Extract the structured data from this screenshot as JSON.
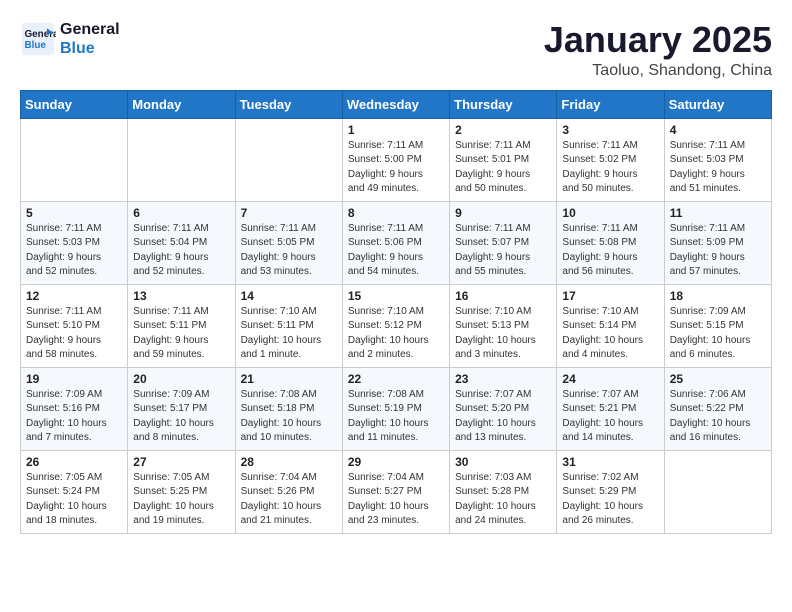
{
  "header": {
    "logo_line1": "General",
    "logo_line2": "Blue",
    "main_title": "January 2025",
    "subtitle": "Taoluo, Shandong, China"
  },
  "days_of_week": [
    "Sunday",
    "Monday",
    "Tuesday",
    "Wednesday",
    "Thursday",
    "Friday",
    "Saturday"
  ],
  "weeks": [
    [
      {
        "day": "",
        "info": ""
      },
      {
        "day": "",
        "info": ""
      },
      {
        "day": "",
        "info": ""
      },
      {
        "day": "1",
        "info": "Sunrise: 7:11 AM\nSunset: 5:00 PM\nDaylight: 9 hours\nand 49 minutes."
      },
      {
        "day": "2",
        "info": "Sunrise: 7:11 AM\nSunset: 5:01 PM\nDaylight: 9 hours\nand 50 minutes."
      },
      {
        "day": "3",
        "info": "Sunrise: 7:11 AM\nSunset: 5:02 PM\nDaylight: 9 hours\nand 50 minutes."
      },
      {
        "day": "4",
        "info": "Sunrise: 7:11 AM\nSunset: 5:03 PM\nDaylight: 9 hours\nand 51 minutes."
      }
    ],
    [
      {
        "day": "5",
        "info": "Sunrise: 7:11 AM\nSunset: 5:03 PM\nDaylight: 9 hours\nand 52 minutes."
      },
      {
        "day": "6",
        "info": "Sunrise: 7:11 AM\nSunset: 5:04 PM\nDaylight: 9 hours\nand 52 minutes."
      },
      {
        "day": "7",
        "info": "Sunrise: 7:11 AM\nSunset: 5:05 PM\nDaylight: 9 hours\nand 53 minutes."
      },
      {
        "day": "8",
        "info": "Sunrise: 7:11 AM\nSunset: 5:06 PM\nDaylight: 9 hours\nand 54 minutes."
      },
      {
        "day": "9",
        "info": "Sunrise: 7:11 AM\nSunset: 5:07 PM\nDaylight: 9 hours\nand 55 minutes."
      },
      {
        "day": "10",
        "info": "Sunrise: 7:11 AM\nSunset: 5:08 PM\nDaylight: 9 hours\nand 56 minutes."
      },
      {
        "day": "11",
        "info": "Sunrise: 7:11 AM\nSunset: 5:09 PM\nDaylight: 9 hours\nand 57 minutes."
      }
    ],
    [
      {
        "day": "12",
        "info": "Sunrise: 7:11 AM\nSunset: 5:10 PM\nDaylight: 9 hours\nand 58 minutes."
      },
      {
        "day": "13",
        "info": "Sunrise: 7:11 AM\nSunset: 5:11 PM\nDaylight: 9 hours\nand 59 minutes."
      },
      {
        "day": "14",
        "info": "Sunrise: 7:10 AM\nSunset: 5:11 PM\nDaylight: 10 hours\nand 1 minute."
      },
      {
        "day": "15",
        "info": "Sunrise: 7:10 AM\nSunset: 5:12 PM\nDaylight: 10 hours\nand 2 minutes."
      },
      {
        "day": "16",
        "info": "Sunrise: 7:10 AM\nSunset: 5:13 PM\nDaylight: 10 hours\nand 3 minutes."
      },
      {
        "day": "17",
        "info": "Sunrise: 7:10 AM\nSunset: 5:14 PM\nDaylight: 10 hours\nand 4 minutes."
      },
      {
        "day": "18",
        "info": "Sunrise: 7:09 AM\nSunset: 5:15 PM\nDaylight: 10 hours\nand 6 minutes."
      }
    ],
    [
      {
        "day": "19",
        "info": "Sunrise: 7:09 AM\nSunset: 5:16 PM\nDaylight: 10 hours\nand 7 minutes."
      },
      {
        "day": "20",
        "info": "Sunrise: 7:09 AM\nSunset: 5:17 PM\nDaylight: 10 hours\nand 8 minutes."
      },
      {
        "day": "21",
        "info": "Sunrise: 7:08 AM\nSunset: 5:18 PM\nDaylight: 10 hours\nand 10 minutes."
      },
      {
        "day": "22",
        "info": "Sunrise: 7:08 AM\nSunset: 5:19 PM\nDaylight: 10 hours\nand 11 minutes."
      },
      {
        "day": "23",
        "info": "Sunrise: 7:07 AM\nSunset: 5:20 PM\nDaylight: 10 hours\nand 13 minutes."
      },
      {
        "day": "24",
        "info": "Sunrise: 7:07 AM\nSunset: 5:21 PM\nDaylight: 10 hours\nand 14 minutes."
      },
      {
        "day": "25",
        "info": "Sunrise: 7:06 AM\nSunset: 5:22 PM\nDaylight: 10 hours\nand 16 minutes."
      }
    ],
    [
      {
        "day": "26",
        "info": "Sunrise: 7:05 AM\nSunset: 5:24 PM\nDaylight: 10 hours\nand 18 minutes."
      },
      {
        "day": "27",
        "info": "Sunrise: 7:05 AM\nSunset: 5:25 PM\nDaylight: 10 hours\nand 19 minutes."
      },
      {
        "day": "28",
        "info": "Sunrise: 7:04 AM\nSunset: 5:26 PM\nDaylight: 10 hours\nand 21 minutes."
      },
      {
        "day": "29",
        "info": "Sunrise: 7:04 AM\nSunset: 5:27 PM\nDaylight: 10 hours\nand 23 minutes."
      },
      {
        "day": "30",
        "info": "Sunrise: 7:03 AM\nSunset: 5:28 PM\nDaylight: 10 hours\nand 24 minutes."
      },
      {
        "day": "31",
        "info": "Sunrise: 7:02 AM\nSunset: 5:29 PM\nDaylight: 10 hours\nand 26 minutes."
      },
      {
        "day": "",
        "info": ""
      }
    ]
  ]
}
